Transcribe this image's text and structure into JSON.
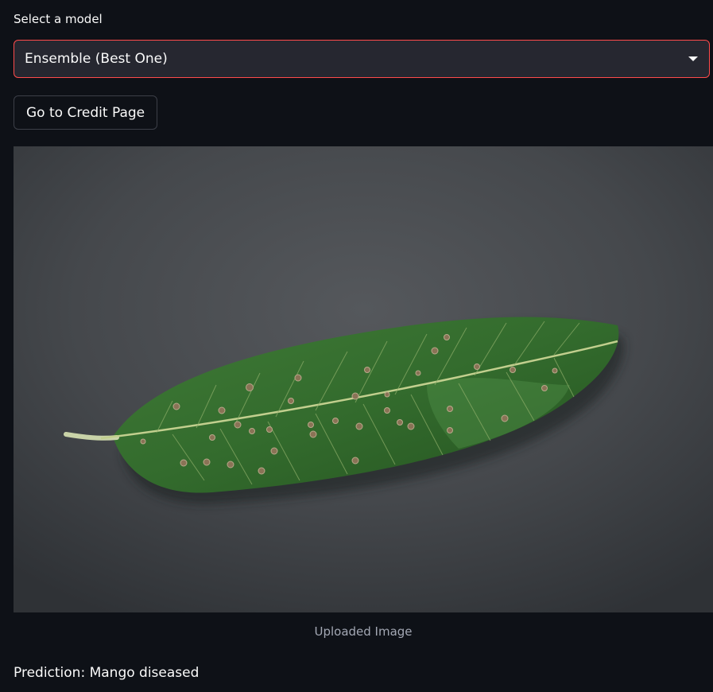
{
  "model_select": {
    "label": "Select a model",
    "selected": "Ensemble (Best One)"
  },
  "credit_button": {
    "label": "Go to Credit Page"
  },
  "image": {
    "caption": "Uploaded Image"
  },
  "prediction": {
    "text": "Prediction: Mango diseased"
  },
  "colors": {
    "accent": "#ff4b4b",
    "background": "#0e1117",
    "input_bg": "#262730"
  },
  "icons": {
    "dropdown": "chevron-down-icon"
  }
}
